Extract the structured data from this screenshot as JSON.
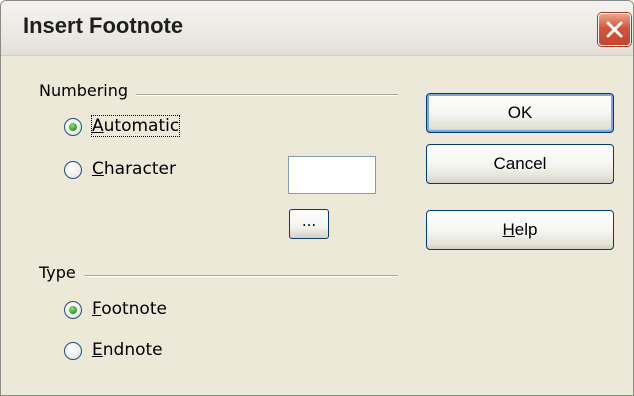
{
  "window": {
    "title": "Insert Footnote",
    "close_icon": "close-icon"
  },
  "numbering": {
    "legend": "Numbering",
    "automatic": {
      "mnemonic": "A",
      "rest": "utomatic",
      "selected": true
    },
    "character": {
      "mnemonic": "C",
      "rest": "haracter",
      "selected": false
    },
    "character_value": "",
    "browse_label": "..."
  },
  "type": {
    "legend": "Type",
    "footnote": {
      "mnemonic": "F",
      "rest": "ootnote",
      "selected": true
    },
    "endnote": {
      "mnemonic": "E",
      "rest": "ndnote",
      "selected": false
    }
  },
  "buttons": {
    "ok": "OK",
    "cancel": "Cancel",
    "help_mnemonic": "H",
    "help_rest": "elp"
  },
  "colors": {
    "dialog_bg": "#ece9d8",
    "close_red": "#d6563a",
    "radio_green": "#34a82a",
    "button_border": "#003c74"
  }
}
